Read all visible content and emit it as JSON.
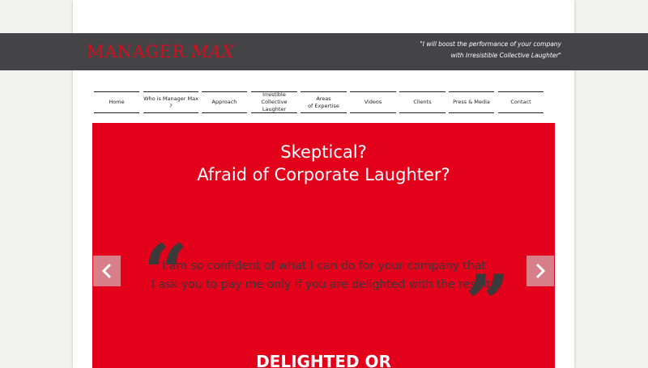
{
  "header": {
    "logo_main": "MANAGER ",
    "logo_accent": "MAX",
    "tagline_line1": "\"I will boost the performance of your company",
    "tagline_line2": "with Irresistible Collective Laughter\""
  },
  "nav": {
    "items": [
      {
        "label": "Home"
      },
      {
        "label": "Who is Manager Max ?"
      },
      {
        "label": "Approach"
      },
      {
        "label_line1": "Irrestible",
        "label_line2": "Collective Laughter"
      },
      {
        "label_line1": "Areas",
        "label_line2": "of Expertise"
      },
      {
        "label": "Videos"
      },
      {
        "label": "Clients"
      },
      {
        "label": "Press & Media"
      },
      {
        "label": "Contact"
      }
    ]
  },
  "hero": {
    "title_line1": "Skeptical?",
    "title_line2": "Afraid of Corporate Laughter?",
    "quote_line1": "I am so confident of what I can do for your company that",
    "quote_line2": "I ask you to pay me only if you are delighted with the results",
    "bottom_heading": "DELIGHTED OR",
    "prev_icon": "chevron-left-icon",
    "next_icon": "chevron-right-icon"
  },
  "colors": {
    "brand_red": "#e2001a",
    "logo_red": "#d3101c",
    "header_dark": "#444446",
    "quote_dark": "#3a3a3a"
  }
}
